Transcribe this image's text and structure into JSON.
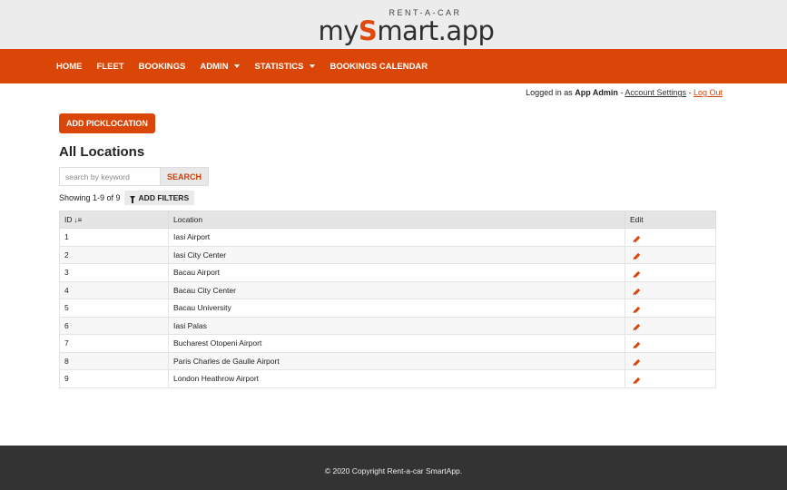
{
  "brand": {
    "tagline": "RENT-A-CAR",
    "logo_prefix": "my",
    "logo_mark": "S",
    "logo_suffix": "mart.app"
  },
  "nav": {
    "items": [
      {
        "label": "HOME"
      },
      {
        "label": "FLEET"
      },
      {
        "label": "BOOKINGS"
      },
      {
        "label": "ADMIN"
      },
      {
        "label": "STATISTICS"
      },
      {
        "label": "BOOKINGS CALENDAR"
      }
    ]
  },
  "user": {
    "prefix": "Logged in as",
    "name": "App Admin",
    "sep1": " - ",
    "account_settings": "Account Settings",
    "sep2": " - ",
    "logout": "Log Out"
  },
  "page": {
    "add_button": "ADD PICKLOCATION",
    "title": "All Locations",
    "search_placeholder": "search by keyword",
    "search_button": "SEARCH",
    "showing": "Showing 1-9 of 9",
    "filters_button": "ADD FILTERS"
  },
  "table": {
    "headers": {
      "id": "ID",
      "location": "Location",
      "edit": "Edit"
    },
    "rows": [
      {
        "id": "1",
        "location": "Iasi Airport"
      },
      {
        "id": "2",
        "location": "Iasi City Center"
      },
      {
        "id": "3",
        "location": "Bacau Airport"
      },
      {
        "id": "4",
        "location": "Bacau City Center"
      },
      {
        "id": "5",
        "location": "Bacau University"
      },
      {
        "id": "6",
        "location": "Iasi Palas"
      },
      {
        "id": "7",
        "location": "Bucharest Otopeni Airport"
      },
      {
        "id": "8",
        "location": "Paris Charles de Gaulle Airport"
      },
      {
        "id": "9",
        "location": "London Heathrow Airport"
      }
    ]
  },
  "footer": {
    "text": "© 2020 Copyright Rent-a-car SmartApp."
  },
  "colors": {
    "accent": "#d94607",
    "header_bg": "#ececec",
    "footer_bg": "#333333"
  },
  "icons": {
    "sort": "sort-amount-icon",
    "filter": "funnel-icon",
    "edit": "pencil-icon"
  }
}
